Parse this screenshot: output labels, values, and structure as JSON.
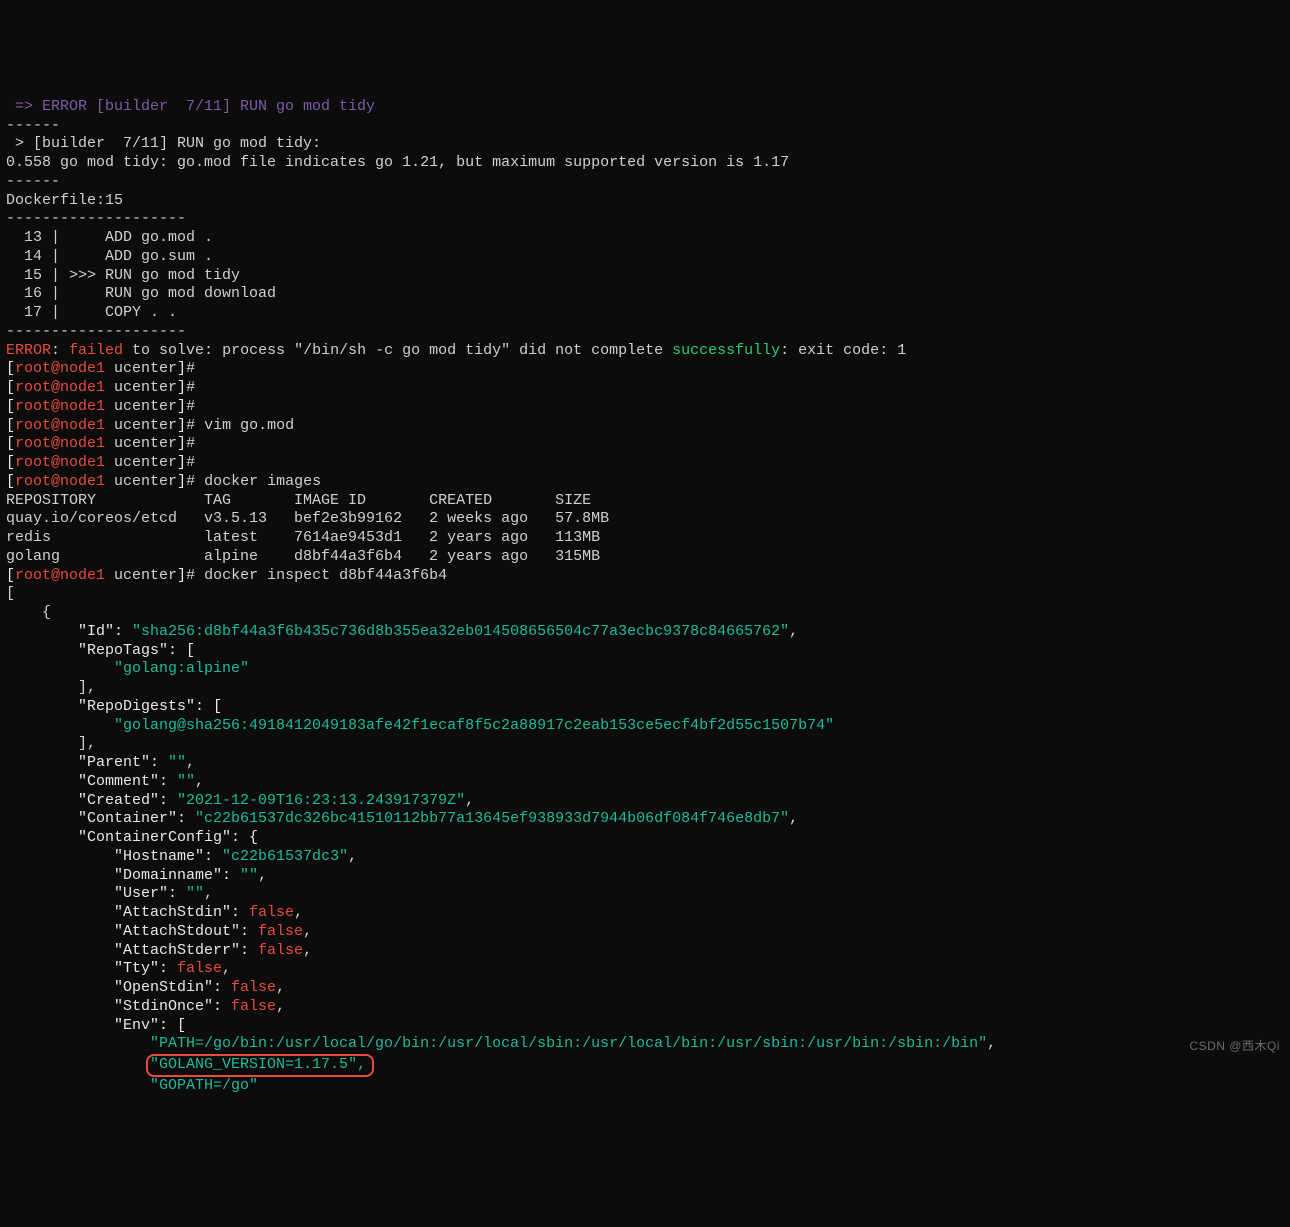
{
  "err_arrow_line": " => ERROR [builder  7/11] RUN go mod tidy",
  "dash_line_short": "------",
  "build_step": " > [builder  7/11] RUN go mod tidy:",
  "mod_error": "0.558 go mod tidy: go.mod file indicates go 1.21, but maximum supported version is 1.17",
  "dockerfile_line": "Dockerfile:15",
  "dash_line_long": "--------------------",
  "df_13": "  13 |     ADD go.mod .",
  "df_14": "  14 |     ADD go.sum .",
  "df_15": "  15 | >>> RUN go mod tidy",
  "df_16": "  16 |     RUN go mod download",
  "df_17": "  17 |     COPY . .",
  "err_label": "ERROR",
  "err_colon": ": ",
  "err_failed": "failed",
  "err_mid": " to solve: process \"/bin/sh -c go mod tidy\" did not complete ",
  "err_success": "successfully",
  "err_tail": ": exit code: 1",
  "prompt_open": "[",
  "prompt_user": "root@node1",
  "prompt_path": " ucenter",
  "prompt_close": "]",
  "prompt_hash": "# ",
  "cmd_vim": "vim go.mod",
  "cmd_images": "docker images",
  "tbl_header": "REPOSITORY            TAG       IMAGE ID       CREATED       SIZE",
  "tbl_row1": "quay.io/coreos/etcd   v3.5.13   bef2e3b99162   2 weeks ago   57.8MB",
  "tbl_row2": "redis                 latest    7614ae9453d1   2 years ago   113MB",
  "tbl_row3": "golang                alpine    d8bf44a3f6b4   2 years ago   315MB",
  "cmd_inspect": "docker inspect d8bf44a3f6b4",
  "inspect_bracket": "[",
  "inspect_brace": "    {",
  "id_key": "        \"Id\": ",
  "id_val": "\"sha256:d8bf44a3f6b435c736d8b355ea32eb014508656504c77a3ecbc9378c84665762\"",
  "repotags_key": "        \"RepoTags\": [",
  "repotags_val": "            \"golang:alpine\"",
  "close_arr": "        ]",
  "repodig_key": "        \"RepoDigests\": [",
  "repodig_val": "            \"golang@sha256:4918412049183afe42f1ecaf8f5c2a88917c2eab153ce5ecf4bf2d55c1507b74\"",
  "parent_key": "        \"Parent\": ",
  "empty_str": "\"\"",
  "comment_key": "        \"Comment\": ",
  "created_key": "        \"Created\": ",
  "created_val": "\"2021-12-09T16:23:13.243917379Z\"",
  "container_key": "        \"Container\": ",
  "container_val": "\"c22b61537dc326bc41510112bb77a13645ef938933d7944b06df084f746e8db7\"",
  "cc_key": "        \"ContainerConfig\": {",
  "hostname_key": "            \"Hostname\": ",
  "hostname_val": "\"c22b61537dc3\"",
  "domain_key": "            \"Domainname\": ",
  "user_key": "            \"User\": ",
  "astdin_key": "            \"AttachStdin\": ",
  "astdout_key": "            \"AttachStdout\": ",
  "astderr_key": "            \"AttachStderr\": ",
  "tty_key": "            \"Tty\": ",
  "ostdin_key": "            \"OpenStdin\": ",
  "sonce_key": "            \"StdinOnce\": ",
  "false_val": "false",
  "env_key": "            \"Env\": [",
  "env_path": "                \"PATH=/go/bin:/usr/local/go/bin:/usr/local/sbin:/usr/local/bin:/usr/sbin:/usr/bin:/sbin:/bin\"",
  "env_gover_pad": "                ",
  "env_gover": "\"GOLANG_VERSION=1.17.5\",",
  "env_gopath": "                \"GOPATH=/go\"",
  "comma": ",",
  "watermark": "CSDN @西木Qi"
}
